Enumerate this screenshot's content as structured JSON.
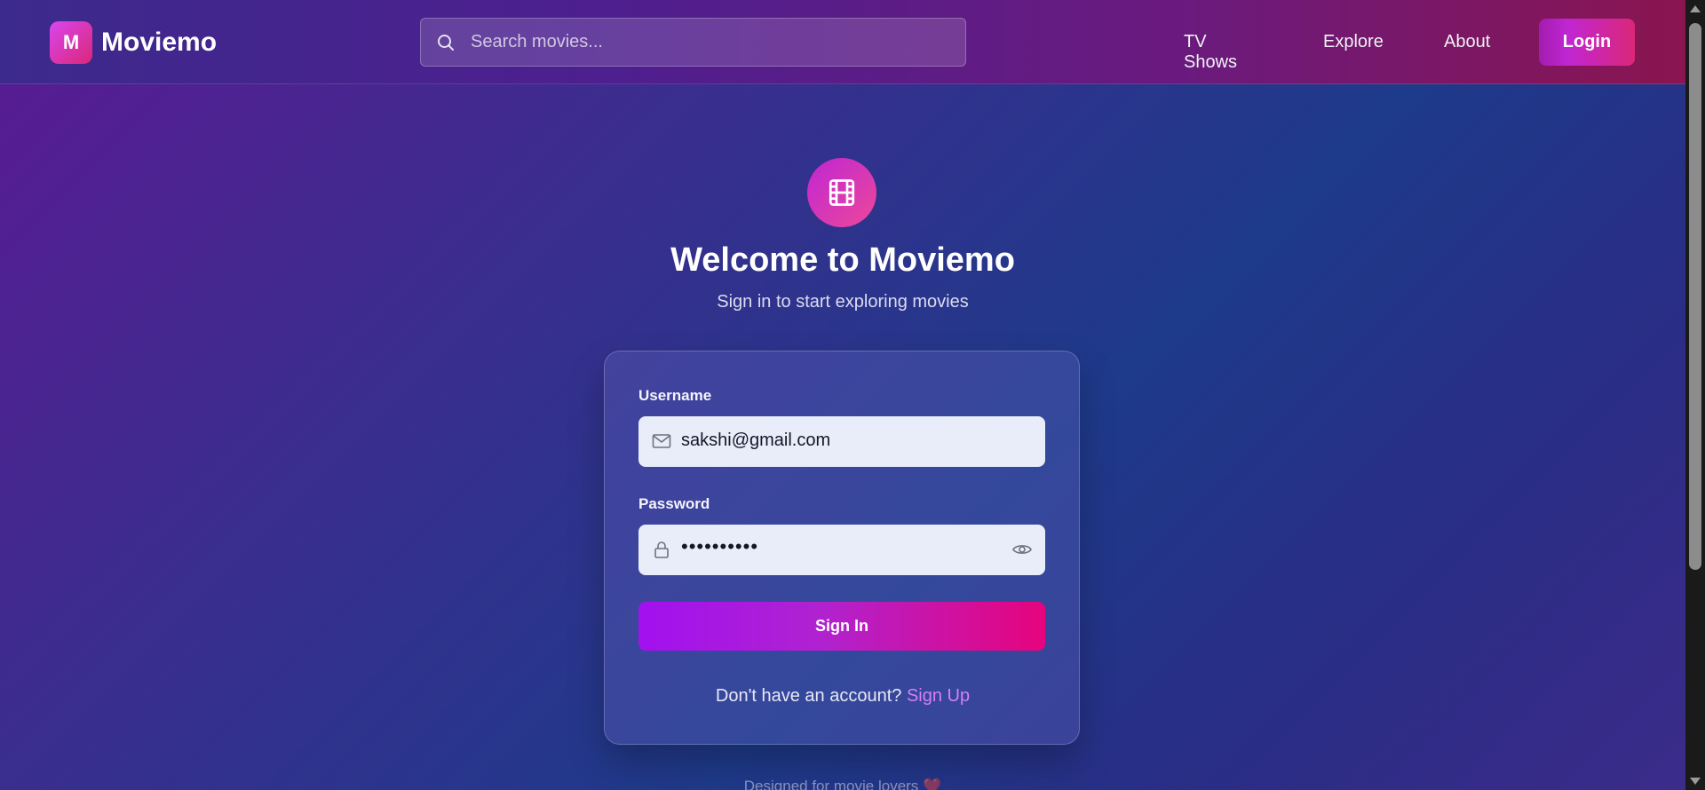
{
  "header": {
    "logo_letter": "M",
    "brand": "Moviemo",
    "search_placeholder": "Search movies...",
    "nav": [
      "TV Shows",
      "Explore",
      "About"
    ],
    "login_label": "Login"
  },
  "hero": {
    "title": "Welcome to Moviemo",
    "subtitle": "Sign in to start exploring movies",
    "icon": "film-icon"
  },
  "form": {
    "username_label": "Username",
    "username_value": "sakshi@gmail.com",
    "password_label": "Password",
    "password_value": "••••••••••",
    "submit_label": "Sign In",
    "signup_prompt": "Don't have an account?",
    "signup_link": "Sign Up"
  },
  "footer": {
    "note": "Designed for movie lovers ❤️"
  },
  "colors": {
    "accent_pink": "#e6047c",
    "accent_purple": "#a211ef",
    "link": "#d580f2"
  },
  "icons": [
    "search-icon",
    "film-icon",
    "mail-icon",
    "lock-icon",
    "eye-icon"
  ]
}
